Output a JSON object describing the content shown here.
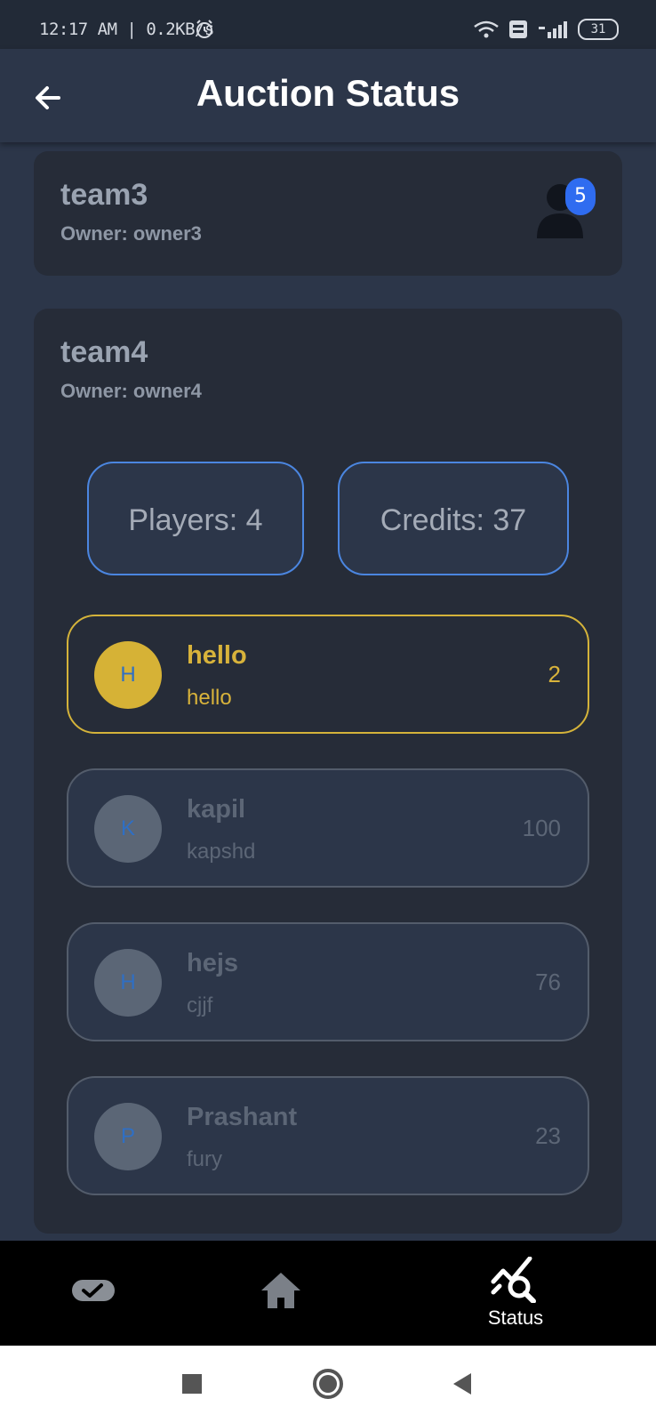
{
  "status_bar": {
    "time": "12:17 AM | 0.2KB/s",
    "battery": "31"
  },
  "app_bar": {
    "title": "Auction Status"
  },
  "teams": [
    {
      "name": "team3",
      "owner": "Owner: owner3",
      "member_badge": "5"
    },
    {
      "name": "team4",
      "owner": "Owner: owner4",
      "players_label": "Players: 4",
      "credits_label": "Credits: 37",
      "players": [
        {
          "initial": "H",
          "name": "hello",
          "sub": "hello",
          "value": "2",
          "active": true
        },
        {
          "initial": "K",
          "name": "kapil",
          "sub": "kapshd",
          "value": "100",
          "active": false
        },
        {
          "initial": "H",
          "name": "hejs",
          "sub": "cjjf",
          "value": "76",
          "active": false
        },
        {
          "initial": "P",
          "name": "Prashant",
          "sub": "fury",
          "value": "23",
          "active": false
        }
      ]
    }
  ],
  "bottom_nav": {
    "items": [
      {
        "icon": "toggle-icon",
        "label": ""
      },
      {
        "icon": "home-icon",
        "label": ""
      },
      {
        "icon": "status-icon",
        "label": "Status"
      }
    ]
  },
  "colors": {
    "background": "#2c3649",
    "card": "#262c38",
    "accent_gold": "#d6b236",
    "accent_blue": "#4b86e0",
    "badge_blue": "#2f6cf0"
  }
}
